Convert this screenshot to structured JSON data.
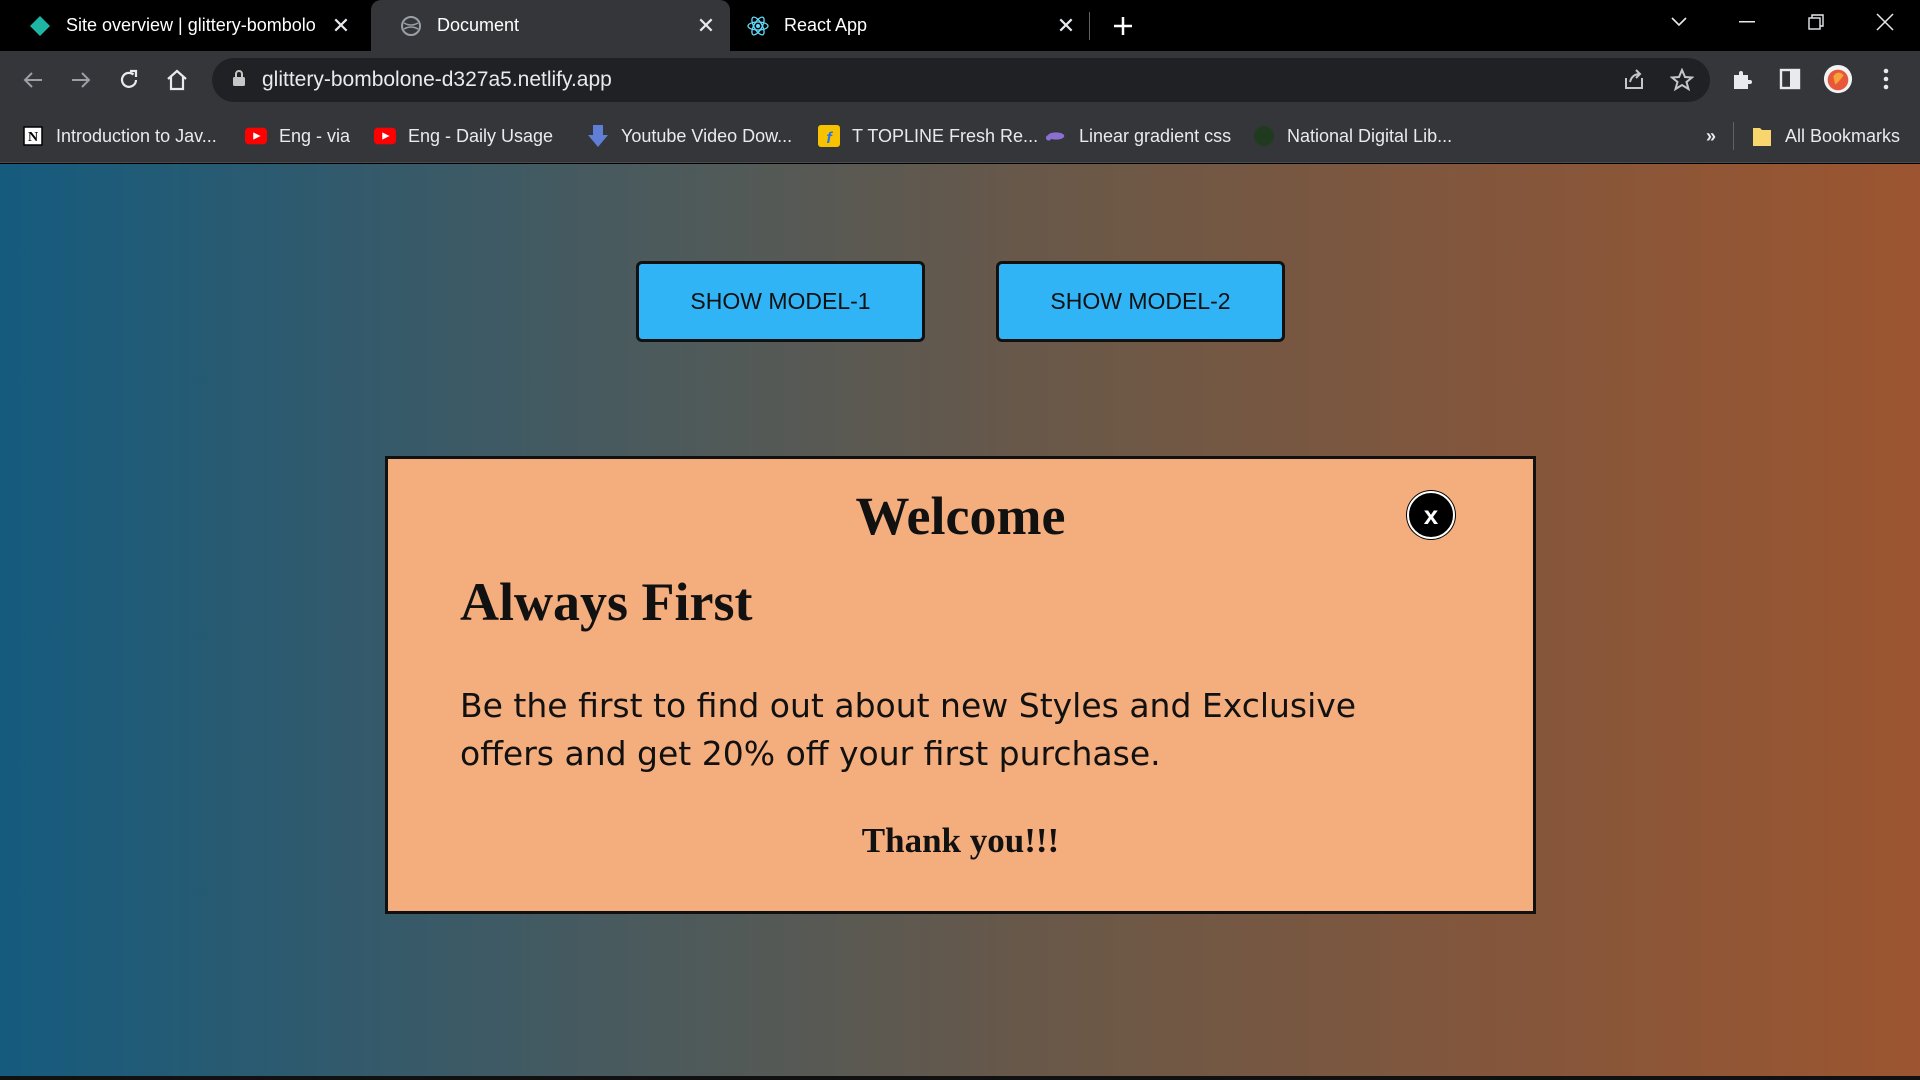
{
  "browser": {
    "tabs": [
      {
        "title": "Site overview | glittery-bombolo",
        "icon": "netlify-icon"
      },
      {
        "title": "Document",
        "icon": "globe-icon"
      },
      {
        "title": "React App",
        "icon": "react-icon"
      }
    ],
    "address": "glittery-bombolone-d327a5.netlify.app",
    "bookmarks": [
      {
        "label": "Introduction to Jav...",
        "icon": "notion-icon"
      },
      {
        "label": "Eng - via",
        "icon": "youtube-icon"
      },
      {
        "label": "Eng -  Daily Usage",
        "icon": "youtube-icon"
      },
      {
        "label": "Youtube Video Dow...",
        "icon": "download-icon"
      },
      {
        "label": "T TOPLINE Fresh Re...",
        "icon": "flipkart-icon"
      },
      {
        "label": "Linear gradient css",
        "icon": "link-icon"
      },
      {
        "label": "National Digital Lib...",
        "icon": "globe-icon"
      }
    ],
    "overflow_label": "»",
    "all_bookmarks": "All Bookmarks"
  },
  "page": {
    "buttons": {
      "model1": "SHOW MODEL-1",
      "model2": "SHOW MODEL-2"
    },
    "modal": {
      "title": "Welcome",
      "close_label": "x",
      "heading": "Always First",
      "text": "Be the first to find out about new Styles and Exclusive offers and get 20% off your first purchase.",
      "thanks": "Thank you!!!"
    }
  },
  "colors": {
    "button_bg": "#30b4f6",
    "modal_bg": "#f4ad7d",
    "gradient_left": "#155b7e",
    "gradient_right": "#9c5530"
  }
}
